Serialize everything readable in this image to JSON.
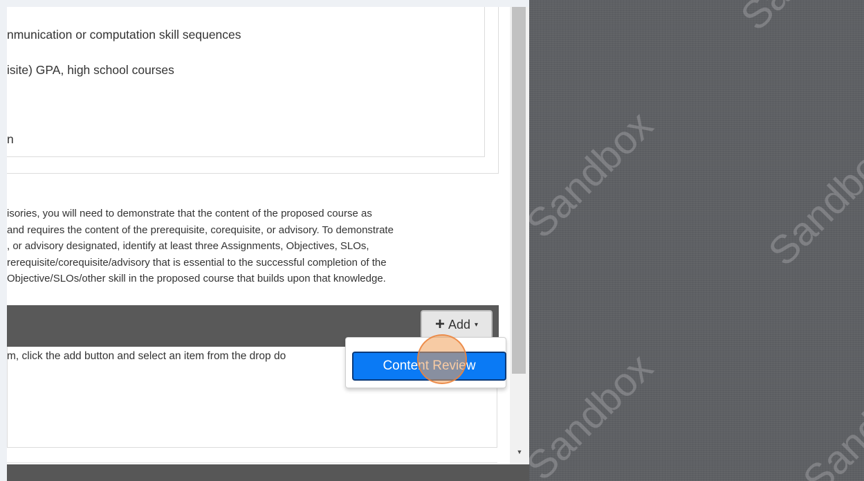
{
  "top_list": [
    "nmunication or computation skill sequences",
    "isite) GPA, high school courses",
    "n"
  ],
  "paragraph_lines": [
    "isories, you will need to demonstrate that the content of the proposed course as",
    "and requires the content of the prerequisite, corequisite, or advisory. To demonstrate",
    ", or advisory designated, identify at least three Assignments, Objectives, SLOs,",
    "rerequisite/corequisite/advisory that is essential to the successful completion of the",
    "Objective/SLOs/other skill in the proposed course that builds upon that knowledge."
  ],
  "section_header": {
    "add_button_plus": "+",
    "add_button_label": "Add",
    "add_button_caret": "▾"
  },
  "empty_hint": "m, click the add button and select an item from the drop do",
  "dropdown": {
    "items": [
      "Content Review"
    ]
  },
  "scrollbar": {
    "down_arrow": "▼"
  },
  "watermark": {
    "text": "Sandbox"
  },
  "colors": {
    "primary": "#0a7af5",
    "header_bg": "#595959",
    "sandbox_bg": "#5e6064"
  }
}
